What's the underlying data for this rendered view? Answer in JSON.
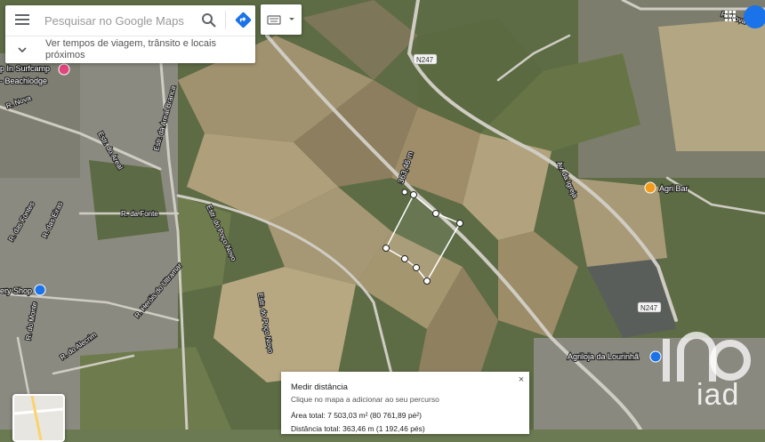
{
  "search": {
    "placeholder": "Pesquisar no Google Maps",
    "travel_text": "Ver tempos de viagem, trânsito e locais próximos"
  },
  "map": {
    "labels": {
      "n247_top": "N247",
      "n247_bottom": "N247",
      "r_nova_left": "R. Nova",
      "r_nova_right": "R. Nova",
      "estr_areal": "Estr. do Areal",
      "estr_areal_branca": "Estr. da Areal Branca",
      "r_fonte": "R. da Fonte",
      "r_eiras": "R. das Eiras",
      "r_fontes": "R. das Fontes",
      "estr_poco_novo_1": "Estr. do Poço Novo",
      "estr_poco_novo_2": "Estr. do Poço Novo",
      "r_herois": "R. Heróis do Ultramar",
      "r_monte": "R. do Monte",
      "r_alecrim": "R. do Alecrim",
      "av_igreja": "Av. da Igreja",
      "segment_length": "363,46 m"
    },
    "places": {
      "surfcamp": "Surfcamp Beachlodge",
      "surfcamp_line1": "p In Surfcamp",
      "surfcamp_line2": "- Beachlodge",
      "agri_bar": "Agri Bar",
      "agriloja": "Agriloja da Lourinhã",
      "shop": "ery Shop"
    },
    "measure_color": "#ffffff"
  },
  "measure": {
    "title": "Medir distância",
    "subtitle": "Clique no mapa a adicionar ao seu percurso",
    "area": "Área total: 7 503,03 m² (80 761,89 pé²)",
    "distance": "Distância total: 363,46 m (1 192,46 pés)",
    "close": "×"
  },
  "watermark": {
    "text": "iad"
  },
  "colors": {
    "fields_dark": "#4d5a36",
    "fields_light": "#a89874",
    "road": "#c9c6bd",
    "pin_pink": "#e0457b",
    "pin_orange": "#f29b1c",
    "pin_blue": "#1a73e8"
  }
}
